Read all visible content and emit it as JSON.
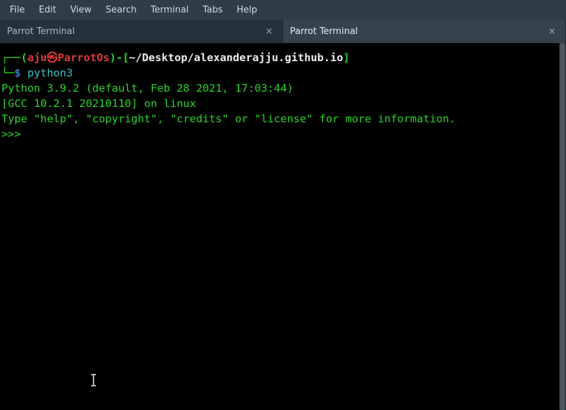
{
  "menubar": {
    "items": [
      "File",
      "Edit",
      "View",
      "Search",
      "Terminal",
      "Tabs",
      "Help"
    ]
  },
  "tabs": [
    {
      "title": "Parrot Terminal",
      "active": false
    },
    {
      "title": "Parrot Terminal",
      "active": true
    }
  ],
  "prompt": {
    "user": "aju",
    "sep_icon": "㉿",
    "host": "ParrotOs",
    "path": "~/Desktop/alexanderajju.github.io",
    "prompt_char": "$",
    "command": "python3"
  },
  "output": {
    "line1": "Python 3.9.2 (default, Feb 28 2021, 17:03:44) ",
    "line2": "[GCC 10.2.1 20210110] on linux",
    "line3": "Type \"help\", \"copyright\", \"credits\" or \"license\" for more information.",
    "repl_prompt": ">>> "
  },
  "glyphs": {
    "box_tl": "┌──",
    "box_bl": "└─",
    "lparen": "(",
    "rparen": ")",
    "lbrack": "[",
    "rbrack": "]",
    "dash_sep": "-",
    "close_x": "×"
  }
}
